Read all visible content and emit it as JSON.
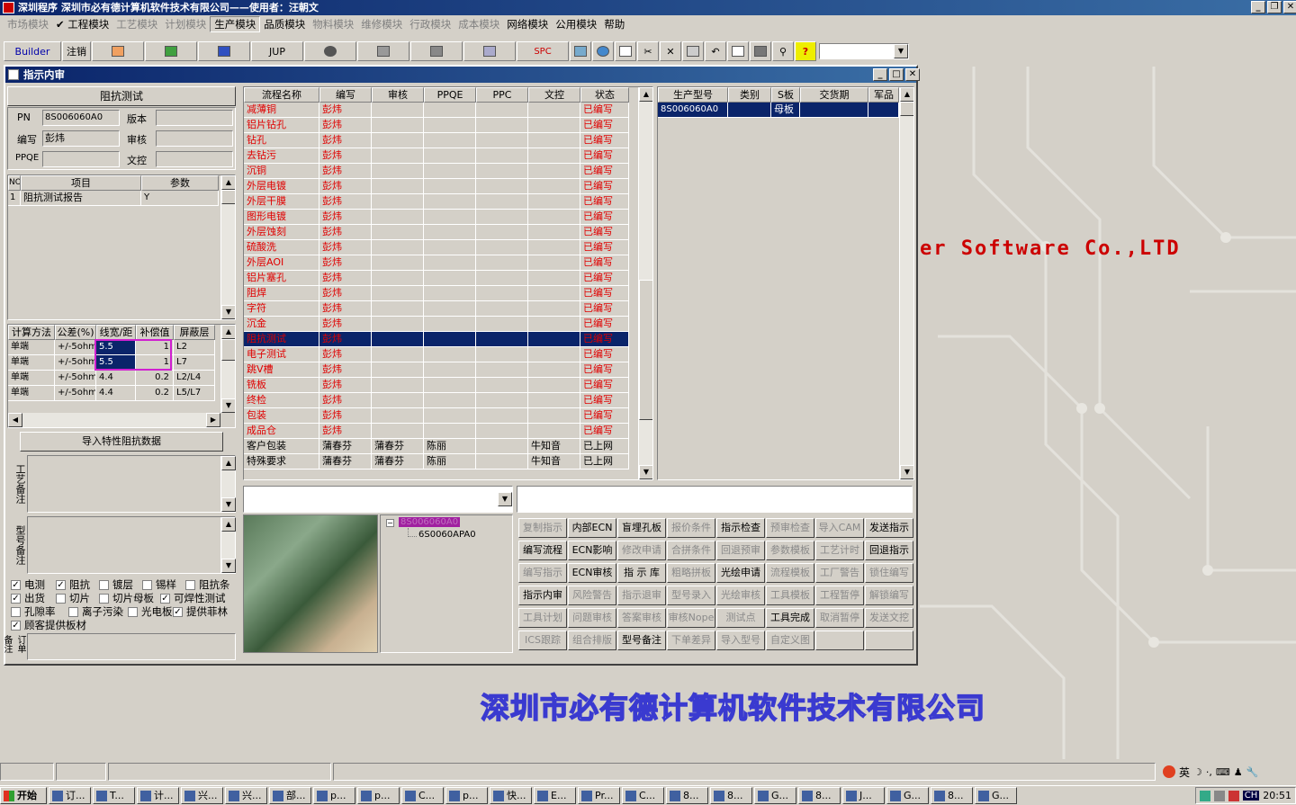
{
  "app": {
    "title": "深圳程序    深圳市必有德计算机软件技术有限公司——使用者：汪朝文"
  },
  "menu": [
    {
      "label": "市场模块",
      "enabled": false
    },
    {
      "label": "✔ 工程模块",
      "enabled": true
    },
    {
      "label": "工艺模块",
      "enabled": false
    },
    {
      "label": "计划模块",
      "enabled": false
    },
    {
      "label": "生产模块",
      "enabled": true
    },
    {
      "label": "品质模块",
      "enabled": true
    },
    {
      "label": "物料模块",
      "enabled": false
    },
    {
      "label": "维修模块",
      "enabled": false
    },
    {
      "label": "行政模块",
      "enabled": false
    },
    {
      "label": "成本模块",
      "enabled": false
    },
    {
      "label": "网络模块",
      "enabled": true
    },
    {
      "label": "公用模块",
      "enabled": true
    },
    {
      "label": "帮助",
      "enabled": true
    }
  ],
  "toolbar": {
    "builder": "Builder",
    "logout": "注销",
    "jup": "JUP",
    "spc": "SPC"
  },
  "desktop": {
    "software_text": "er Software Co.,LTD",
    "company_banner": "深圳市必有德计算机软件技术有限公司"
  },
  "child": {
    "title": "指示内审",
    "left": {
      "header": "阻抗测试",
      "pn_label": "PN",
      "pn_value": "8S006060A0",
      "version_label": "版本",
      "version_value": "",
      "author_label": "编写",
      "author_value": "彭炜",
      "review_label": "审核",
      "review_value": "",
      "ppqe_label": "PPQE",
      "ppqe_value": "",
      "doc_label": "文控",
      "doc_value": "",
      "items_headers": [
        "NO",
        "项目",
        "参数"
      ],
      "items": [
        [
          "1",
          "阻抗测试报告",
          "Y"
        ]
      ],
      "calc_headers": [
        "计算方法",
        "公差(%)",
        "线宽/距",
        "补偿值",
        "屏蔽层"
      ],
      "calc_rows": [
        [
          "单端",
          "+/-5ohm",
          "5.5",
          "1",
          "L2"
        ],
        [
          "单端",
          "+/-5ohm",
          "5.5",
          "1",
          "L7"
        ],
        [
          "单端",
          "+/-5ohm",
          "4.4",
          "0.2",
          "L2/L4"
        ],
        [
          "单端",
          "+/-5ohm",
          "4.4",
          "0.2",
          "L5/L7"
        ]
      ],
      "import_button": "导入特性阻抗数据",
      "craft_note_label": "工艺备注",
      "model_note_label": "型号备注",
      "order_note_label": "订单备注",
      "checkboxes": [
        {
          "label": "电测",
          "checked": true
        },
        {
          "label": "阻抗",
          "checked": true
        },
        {
          "label": "镀层",
          "checked": false
        },
        {
          "label": "锡样",
          "checked": false
        },
        {
          "label": "阻抗条",
          "checked": false
        },
        {
          "label": "出货",
          "checked": true
        },
        {
          "label": "切片",
          "checked": false
        },
        {
          "label": "切片母板",
          "checked": false
        },
        {
          "label": "可焊性测试",
          "checked": true
        },
        {
          "label": "孔隙率",
          "checked": false
        },
        {
          "label": "离子污染",
          "checked": false
        },
        {
          "label": "光电板",
          "checked": false
        },
        {
          "label": "提供菲林",
          "checked": true
        },
        {
          "label": "顾客提供板材",
          "checked": true
        }
      ]
    },
    "flow": {
      "headers": [
        "流程名称",
        "编写",
        "审核",
        "PPQE",
        "PPC",
        "文控",
        "状态"
      ],
      "rows": [
        [
          "减薄铜",
          "彭炜",
          "",
          "",
          "",
          "",
          "已编写"
        ],
        [
          "铝片钻孔",
          "彭炜",
          "",
          "",
          "",
          "",
          "已编写"
        ],
        [
          "钻孔",
          "彭炜",
          "",
          "",
          "",
          "",
          "已编写"
        ],
        [
          "去钻污",
          "彭炜",
          "",
          "",
          "",
          "",
          "已编写"
        ],
        [
          "沉铜",
          "彭炜",
          "",
          "",
          "",
          "",
          "已编写"
        ],
        [
          "外层电镀",
          "彭炜",
          "",
          "",
          "",
          "",
          "已编写"
        ],
        [
          "外层干膜",
          "彭炜",
          "",
          "",
          "",
          "",
          "已编写"
        ],
        [
          "图形电镀",
          "彭炜",
          "",
          "",
          "",
          "",
          "已编写"
        ],
        [
          "外层蚀刻",
          "彭炜",
          "",
          "",
          "",
          "",
          "已编写"
        ],
        [
          "硫酸洗",
          "彭炜",
          "",
          "",
          "",
          "",
          "已编写"
        ],
        [
          "外层AOI",
          "彭炜",
          "",
          "",
          "",
          "",
          "已编写"
        ],
        [
          "铝片塞孔",
          "彭炜",
          "",
          "",
          "",
          "",
          "已编写"
        ],
        [
          "阻焊",
          "彭炜",
          "",
          "",
          "",
          "",
          "已编写"
        ],
        [
          "字符",
          "彭炜",
          "",
          "",
          "",
          "",
          "已编写"
        ],
        [
          "沉金",
          "彭炜",
          "",
          "",
          "",
          "",
          "已编写"
        ],
        [
          "阻抗测试",
          "彭炜",
          "",
          "",
          "",
          "",
          "已编写"
        ],
        [
          "电子测试",
          "彭炜",
          "",
          "",
          "",
          "",
          "已编写"
        ],
        [
          "跳V槽",
          "彭炜",
          "",
          "",
          "",
          "",
          "已编写"
        ],
        [
          "铣板",
          "彭炜",
          "",
          "",
          "",
          "",
          "已编写"
        ],
        [
          "终检",
          "彭炜",
          "",
          "",
          "",
          "",
          "已编写"
        ],
        [
          "包装",
          "彭炜",
          "",
          "",
          "",
          "",
          "已编写"
        ],
        [
          "成品仓",
          "彭炜",
          "",
          "",
          "",
          "",
          "已编写"
        ],
        [
          "客户包装",
          "蒲春芬",
          "蒲春芬",
          "陈丽",
          "",
          "牛知音",
          "已上网"
        ],
        [
          "特殊要求",
          "蒲春芬",
          "蒲春芬",
          "陈丽",
          "",
          "牛知音",
          "已上网"
        ]
      ],
      "selected_index": 15
    },
    "models": {
      "headers": [
        "生产型号",
        "类别",
        "S板",
        "交货期",
        "军品"
      ],
      "rows": [
        [
          "8S006060A0",
          "",
          "母板",
          "",
          ""
        ]
      ]
    },
    "tree": {
      "root": "8S006060A0",
      "child": "6S0060APA0"
    },
    "actions": [
      [
        {
          "label": "复制指示",
          "enabled": false
        },
        {
          "label": "内部ECN",
          "enabled": true
        },
        {
          "label": "盲埋孔板",
          "enabled": true
        },
        {
          "label": "报价条件",
          "enabled": false
        },
        {
          "label": "指示检查",
          "enabled": true
        },
        {
          "label": "预审检查",
          "enabled": false
        },
        {
          "label": "导入CAM",
          "enabled": false
        },
        {
          "label": "发送指示",
          "enabled": true
        }
      ],
      [
        {
          "label": "编写流程",
          "enabled": true
        },
        {
          "label": "ECN影响",
          "enabled": true
        },
        {
          "label": "修改申请",
          "enabled": false
        },
        {
          "label": "合拼条件",
          "enabled": false
        },
        {
          "label": "回退预审",
          "enabled": false
        },
        {
          "label": "参数模板",
          "enabled": false
        },
        {
          "label": "工艺计时",
          "enabled": false
        },
        {
          "label": "回退指示",
          "enabled": true
        }
      ],
      [
        {
          "label": "编写指示",
          "enabled": false
        },
        {
          "label": "ECN审核",
          "enabled": true
        },
        {
          "label": "指 示 库",
          "enabled": true
        },
        {
          "label": "粗略拼板",
          "enabled": false
        },
        {
          "label": "光绘申请",
          "enabled": true
        },
        {
          "label": "流程模板",
          "enabled": false
        },
        {
          "label": "工厂警告",
          "enabled": false
        },
        {
          "label": "锁住编写",
          "enabled": false
        }
      ],
      [
        {
          "label": "指示内审",
          "enabled": true
        },
        {
          "label": "风险警告",
          "enabled": false
        },
        {
          "label": "指示退审",
          "enabled": false
        },
        {
          "label": "型号录入",
          "enabled": false
        },
        {
          "label": "光绘审核",
          "enabled": false
        },
        {
          "label": "工具模板",
          "enabled": false
        },
        {
          "label": "工程暂停",
          "enabled": false
        },
        {
          "label": "解锁编写",
          "enabled": false
        }
      ],
      [
        {
          "label": "工具计划",
          "enabled": false
        },
        {
          "label": "问题审核",
          "enabled": false
        },
        {
          "label": "答案审核",
          "enabled": false
        },
        {
          "label": "审核Nope",
          "enabled": false
        },
        {
          "label": "测试点",
          "enabled": false
        },
        {
          "label": "工具完成",
          "enabled": true
        },
        {
          "label": "取消暂停",
          "enabled": false
        },
        {
          "label": "发送文挖",
          "enabled": false
        }
      ],
      [
        {
          "label": "ICS跟踪",
          "enabled": false
        },
        {
          "label": "组合排版",
          "enabled": false
        },
        {
          "label": "型号备注",
          "enabled": true
        },
        {
          "label": "下单差异",
          "enabled": false
        },
        {
          "label": "导入型号",
          "enabled": false
        },
        {
          "label": "自定义图",
          "enabled": false
        },
        {
          "label": "",
          "enabled": false
        },
        {
          "label": "",
          "enabled": false
        }
      ]
    ]
  },
  "taskbar": {
    "start": "开始",
    "tasks": [
      "订...",
      "T...",
      "计...",
      "兴...",
      "兴...",
      "部...",
      "p...",
      "p...",
      "C...",
      "p...",
      "快...",
      "E...",
      "Pr...",
      "C...",
      "8...",
      "8...",
      "G...",
      "8...",
      "J...",
      "G...",
      "8...",
      "G..."
    ],
    "clock": "20:51",
    "ime": "英"
  }
}
